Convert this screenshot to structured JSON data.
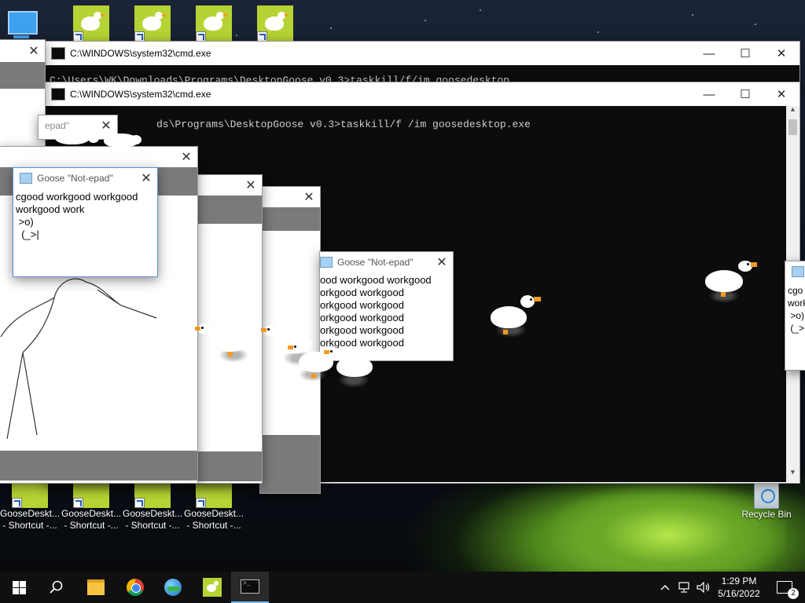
{
  "desktop": {
    "top_icons": [
      {
        "name": "goose-1"
      },
      {
        "name": "goose-2"
      },
      {
        "name": "goose-3"
      },
      {
        "name": "goose-4"
      }
    ],
    "bottom_icons": [
      {
        "line1": "GooseDeskt...",
        "line2": "- Shortcut -..."
      },
      {
        "line1": "GooseDeskt...",
        "line2": "- Shortcut -..."
      },
      {
        "line1": "GooseDeskt...",
        "line2": "- Shortcut -..."
      },
      {
        "line1": "GooseDeskt...",
        "line2": "- Shortcut -..."
      }
    ],
    "recycle_bin": "Recycle Bin"
  },
  "cmd_back": {
    "title": "C:\\WINDOWS\\system32\\cmd.exe",
    "visible_line": "C:\\Users\\WK\\Downloads\\Programs\\DesktopGoose v0.3>taskkill/f/im goosedesktop"
  },
  "cmd_front": {
    "title": "C:\\WINDOWS\\system32\\cmd.exe",
    "line": "ds\\Programs\\DesktopGoose v0.3>taskkill/f /im goosedesktop.exe",
    "minimize": "—",
    "maximize": "☐",
    "close": "✕"
  },
  "notepad_main": {
    "title": "Goose \"Not-epad\"",
    "text": "cgood workgood workgood\nworkgood work\n >o)\n  (_>|"
  },
  "notepad_small": {
    "title": "epad\""
  },
  "notepad_center": {
    "title": "Goose \"Not-epad\"",
    "lines": [
      "ood workgood workgood",
      "orkgood workgood",
      "orkgood workgood",
      "orkgood workgood",
      "orkgood workgood",
      "orkgood workgood"
    ]
  },
  "notepad_right": {
    "text": "cgo\nwork\n >o)\n (_>"
  },
  "taskbar": {
    "time": "1:29 PM",
    "date": "5/16/2022",
    "notifications": "2"
  },
  "colors": {
    "accent": "#0078d7",
    "goose_tile": "#b5d334",
    "beak": "#f39a1f"
  }
}
